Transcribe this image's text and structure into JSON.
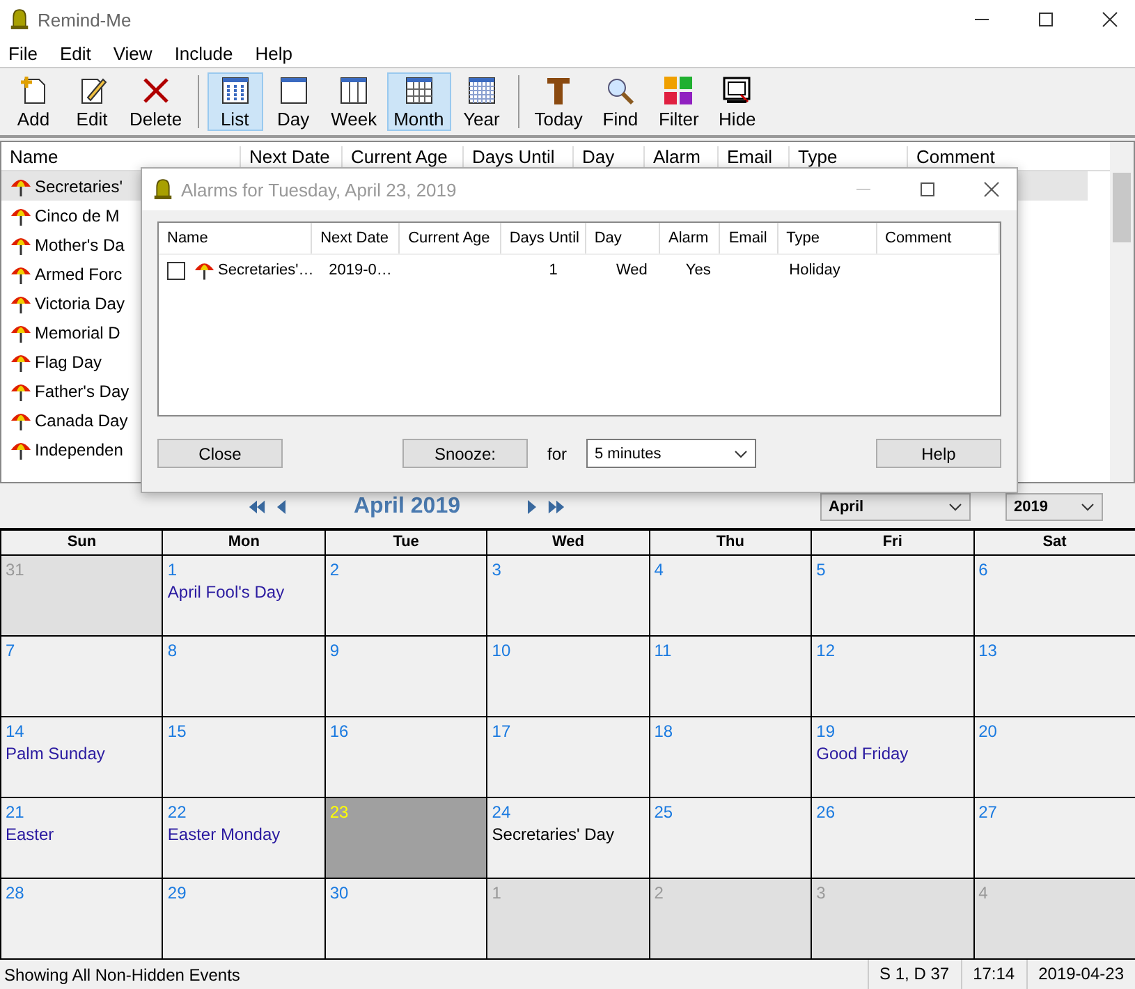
{
  "window": {
    "title": "Remind-Me"
  },
  "menu": [
    "File",
    "Edit",
    "View",
    "Include",
    "Help"
  ],
  "toolbar": [
    {
      "kind": "add",
      "label": "Add",
      "selected": false
    },
    {
      "kind": "edit",
      "label": "Edit",
      "selected": false
    },
    {
      "kind": "delete",
      "label": "Delete",
      "selected": false
    },
    {
      "kind": "separator"
    },
    {
      "kind": "list",
      "label": "List",
      "selected": true
    },
    {
      "kind": "day",
      "label": "Day",
      "selected": false
    },
    {
      "kind": "week",
      "label": "Week",
      "selected": false
    },
    {
      "kind": "month",
      "label": "Month",
      "selected": true
    },
    {
      "kind": "year",
      "label": "Year",
      "selected": false
    },
    {
      "kind": "separator"
    },
    {
      "kind": "today",
      "label": "Today",
      "selected": false
    },
    {
      "kind": "find",
      "label": "Find",
      "selected": false
    },
    {
      "kind": "filter",
      "label": "Filter",
      "selected": false
    },
    {
      "kind": "hide",
      "label": "Hide",
      "selected": false
    }
  ],
  "event_list": {
    "columns": [
      "Name",
      "Next Date",
      "Current Age",
      "Days Until",
      "Day",
      "Alarm",
      "Email",
      "Type",
      "Comment"
    ],
    "rows": [
      {
        "name": "Secretaries'",
        "selected": true
      },
      {
        "name": "Cinco de M",
        "selected": false
      },
      {
        "name": "Mother's Da",
        "selected": false
      },
      {
        "name": "Armed Forc",
        "selected": false
      },
      {
        "name": "Victoria Day",
        "selected": false
      },
      {
        "name": "Memorial D",
        "selected": false
      },
      {
        "name": "Flag Day",
        "selected": false
      },
      {
        "name": "Father's Day",
        "selected": false
      },
      {
        "name": "Canada Day",
        "selected": false
      },
      {
        "name": "Independen",
        "selected": false
      }
    ]
  },
  "alarm_dialog": {
    "title": "Alarms for Tuesday, April 23, 2019",
    "columns": [
      "Name",
      "Next Date",
      "Current Age",
      "Days Until",
      "Day",
      "Alarm",
      "Email",
      "Type",
      "Comment"
    ],
    "rows": [
      {
        "checked": false,
        "cells": [
          "Secretaries'…",
          "2019-0…",
          "",
          "1",
          "Wed",
          "Yes",
          "",
          "Holiday",
          ""
        ]
      }
    ],
    "close_button": "Close",
    "snooze_button": "Snooze:",
    "for_label": "for",
    "snooze_duration": "5 minutes",
    "help_button": "Help"
  },
  "calendar": {
    "title": "April 2019",
    "month_select": "April",
    "year_select": "2019",
    "weekdays": [
      "Sun",
      "Mon",
      "Tue",
      "Wed",
      "Thu",
      "Fri",
      "Sat"
    ],
    "days": [
      {
        "day": "31",
        "kind": "other"
      },
      {
        "day": "1",
        "kind": "current",
        "event": {
          "text": "April Fool's Day",
          "color": "#2a1aa0"
        }
      },
      {
        "day": "2",
        "kind": "current"
      },
      {
        "day": "3",
        "kind": "current"
      },
      {
        "day": "4",
        "kind": "current"
      },
      {
        "day": "5",
        "kind": "current"
      },
      {
        "day": "6",
        "kind": "current"
      },
      {
        "day": "7",
        "kind": "current"
      },
      {
        "day": "8",
        "kind": "current"
      },
      {
        "day": "9",
        "kind": "current"
      },
      {
        "day": "10",
        "kind": "current"
      },
      {
        "day": "11",
        "kind": "current"
      },
      {
        "day": "12",
        "kind": "current"
      },
      {
        "day": "13",
        "kind": "current"
      },
      {
        "day": "14",
        "kind": "current",
        "event": {
          "text": "Palm Sunday",
          "color": "#2a1aa0"
        }
      },
      {
        "day": "15",
        "kind": "current"
      },
      {
        "day": "16",
        "kind": "current"
      },
      {
        "day": "17",
        "kind": "current"
      },
      {
        "day": "18",
        "kind": "current"
      },
      {
        "day": "19",
        "kind": "current",
        "event": {
          "text": "Good Friday",
          "color": "#2a1aa0"
        }
      },
      {
        "day": "20",
        "kind": "current"
      },
      {
        "day": "21",
        "kind": "current",
        "event": {
          "text": "Easter",
          "color": "#2a1aa0"
        }
      },
      {
        "day": "22",
        "kind": "current",
        "event": {
          "text": "Easter Monday",
          "color": "#2a1aa0"
        }
      },
      {
        "day": "23",
        "kind": "today"
      },
      {
        "day": "24",
        "kind": "current",
        "event": {
          "text": "Secretaries' Day",
          "color": "#000000"
        }
      },
      {
        "day": "25",
        "kind": "current"
      },
      {
        "day": "26",
        "kind": "current"
      },
      {
        "day": "27",
        "kind": "current"
      },
      {
        "day": "28",
        "kind": "current"
      },
      {
        "day": "29",
        "kind": "current"
      },
      {
        "day": "30",
        "kind": "current"
      },
      {
        "day": "1",
        "kind": "other"
      },
      {
        "day": "2",
        "kind": "other"
      },
      {
        "day": "3",
        "kind": "other"
      },
      {
        "day": "4",
        "kind": "other"
      }
    ]
  },
  "status_bar": {
    "message": "Showing All Non-Hidden Events",
    "position": "S 1, D 37",
    "time": "17:14",
    "date": "2019-04-23"
  }
}
